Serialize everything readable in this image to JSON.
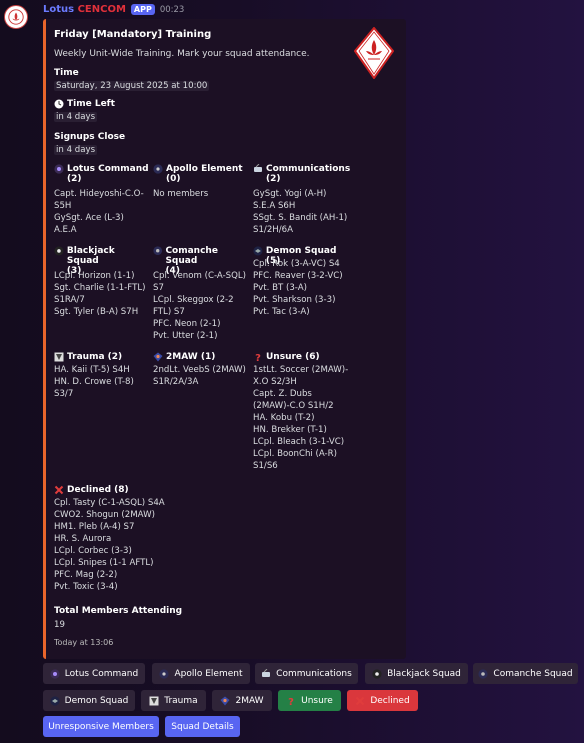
{
  "message": {
    "bot_name_a": "Lotus ",
    "bot_name_b": "CENCOM",
    "app_badge": "APP",
    "time": "00:23"
  },
  "embed": {
    "title": "Friday [Mandatory] Training",
    "description": "Weekly Unit-Wide Training. Mark your squad attendance.",
    "time_label": "Time",
    "time_value": "Saturday, 23 August 2025 at 10:00",
    "time_left_label": "Time Left",
    "time_left_value": "in 4 days",
    "signups_label": "Signups Close",
    "signups_value": "in 4 days",
    "groups": [
      {
        "name": "Lotus Command",
        "count": "(2)",
        "icon": "lotus-icon",
        "members": "Capt. Hideyoshi-C.O-\nS5H\nGySgt. Ace (L-3) A.E.A"
      },
      {
        "name": "Apollo Element",
        "count": "(0)",
        "icon": "apollo-icon",
        "members": "No members"
      },
      {
        "name": "Communications",
        "count": "(2)",
        "icon": "satellite-icon",
        "members": "GySgt. Yogi (A-H)\nS.E.A S6H\nSSgt. S. Bandit (AH-1)\nS1/2H/6A"
      },
      {
        "name": "Blackjack Squad",
        "count": "(3)",
        "icon": "blackjack-icon",
        "members": "LCpl. Horizon (1-1)\nSgt. Charlie (1-1-FTL)\nS1RA/7\nSgt. Tyler (B-A) S7H"
      },
      {
        "name": "Comanche Squad",
        "count": "(4)",
        "icon": "comanche-icon",
        "members": "Cpl. Venom (C-A-SQL)\nS7\nLCpl. Skeggox (2-2\nFTL) S7\nPFC. Neon (2-1)\nPvt. Utter (2-1)"
      },
      {
        "name": "Demon Squad (5)",
        "count": "",
        "icon": "demon-icon",
        "members": "Cpl. Rok (3-A-VC) S4\nPFC. Reaver (3-2-VC)\nPvt. BT (3-A)\nPvt. Sharkson (3-3)\nPvt. Tac (3-A)"
      },
      {
        "name": "Trauma (2)",
        "count": "",
        "icon": "trauma-icon",
        "members": "HA. Kaii (T-5) S4H\nHN. D. Crowe (T-8)\nS3/7"
      },
      {
        "name": "2MAW (1)",
        "count": "",
        "icon": "2maw-icon",
        "members": "2ndLt. VeebS (2MAW)\nS1R/2A/3A"
      },
      {
        "name": "Unsure (6)",
        "count": "",
        "icon": "question-icon",
        "members": "1stLt. Soccer (2MAW)-\nX.O S2/3H\nCapt. Z. Dubs\n(2MAW)-C.O S1H/2\nHA. Kobu (T-2)\nHN. Brekker (T-1)\nLCpl. Bleach (3-1-VC)\nLCpl. BoonChi (A-R)\nS1/S6"
      },
      {
        "name": "Declined (8)",
        "count": "",
        "icon": "cross-icon",
        "members": "Cpl. Tasty (C-1-ASQL) S4A\nCWO2. Shogun (2MAW)\nHM1. Pleb (A-4) S7\nHR. S. Aurora\nLCpl. Corbec (3-3)\nLCpl. Snipes (1-1 AFTL)\nPFC. Mag (2-2)\nPvt. Toxic (3-4)"
      }
    ],
    "total_label": "Total Members Attending",
    "total_value": "19",
    "footer": "Today at 13:06"
  },
  "buttons": [
    {
      "label": "Lotus Command",
      "icon": "lotus-icon"
    },
    {
      "label": "Apollo Element",
      "icon": "apollo-icon"
    },
    {
      "label": "Communications",
      "icon": "satellite-icon"
    },
    {
      "label": "Blackjack Squad",
      "icon": "blackjack-icon"
    },
    {
      "label": "Comanche Squad",
      "icon": "comanche-icon"
    },
    {
      "label": "Demon Squad",
      "icon": "demon-icon"
    },
    {
      "label": "Trauma",
      "icon": "trauma-icon"
    },
    {
      "label": "2MAW",
      "icon": "2maw-icon"
    },
    {
      "label": "Unsure",
      "icon": "question-icon"
    },
    {
      "label": "Declined",
      "icon": "cross-icon"
    },
    {
      "label": "Unresponsive Members",
      "icon": ""
    },
    {
      "label": "Squad Details",
      "icon": ""
    }
  ],
  "colors": {
    "accent": "#e9652b",
    "brand": "#5865f2",
    "green": "#248046",
    "red": "#da373c"
  }
}
